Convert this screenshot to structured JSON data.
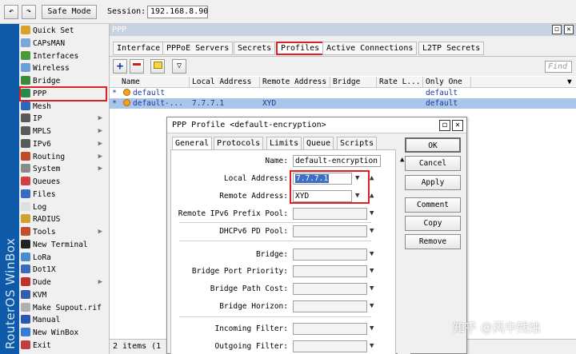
{
  "topbar": {
    "undo_icon": "undo-icon",
    "redo_icon": "redo-icon",
    "safe_mode_label": "Safe Mode",
    "session_label": "Session:",
    "session_value": "192.168.8.90"
  },
  "sidebar": {
    "brand_text": "RouterOS WinBox",
    "items": [
      {
        "label": "Quick Set",
        "icon": "quick-set-icon",
        "color": "#d9a02a",
        "arrow": false
      },
      {
        "label": "CAPsMAN",
        "icon": "capsman-icon",
        "color": "#7aa6d8",
        "arrow": false
      },
      {
        "label": "Interfaces",
        "icon": "interfaces-icon",
        "color": "#4a9a3a",
        "arrow": false
      },
      {
        "label": "Wireless",
        "icon": "wireless-icon",
        "color": "#6aa0d8",
        "arrow": false
      },
      {
        "label": "Bridge",
        "icon": "bridge-icon",
        "color": "#3a8a3a",
        "arrow": false
      },
      {
        "label": "PPP",
        "icon": "ppp-icon",
        "color": "#2a8a4a",
        "arrow": false
      },
      {
        "label": "Mesh",
        "icon": "mesh-icon",
        "color": "#2a6ab8",
        "arrow": false
      },
      {
        "label": "IP",
        "icon": "ip-icon",
        "color": "#5a5a5a",
        "arrow": true
      },
      {
        "label": "MPLS",
        "icon": "mpls-icon",
        "color": "#5a5a5a",
        "arrow": true
      },
      {
        "label": "IPv6",
        "icon": "ipv6-icon",
        "color": "#5a5a5a",
        "arrow": true
      },
      {
        "label": "Routing",
        "icon": "routing-icon",
        "color": "#c04a2a",
        "arrow": true
      },
      {
        "label": "System",
        "icon": "system-icon",
        "color": "#8a8a8a",
        "arrow": true
      },
      {
        "label": "Queues",
        "icon": "queues-icon",
        "color": "#d04040",
        "arrow": false
      },
      {
        "label": "Files",
        "icon": "files-icon",
        "color": "#3a6ac8",
        "arrow": false
      },
      {
        "label": "Log",
        "icon": "log-icon",
        "color": "#e0e0e0",
        "arrow": false
      },
      {
        "label": "RADIUS",
        "icon": "radius-icon",
        "color": "#d0a030",
        "arrow": false
      },
      {
        "label": "Tools",
        "icon": "tools-icon",
        "color": "#c05030",
        "arrow": true
      },
      {
        "label": "New Terminal",
        "icon": "terminal-icon",
        "color": "#222222",
        "arrow": false
      },
      {
        "label": "LoRa",
        "icon": "lora-icon",
        "color": "#4a8ad0",
        "arrow": false
      },
      {
        "label": "Dot1X",
        "icon": "dot1x-icon",
        "color": "#3a6ab8",
        "arrow": false
      },
      {
        "label": "Dude",
        "icon": "dude-icon",
        "color": "#c03030",
        "arrow": true
      },
      {
        "label": "KVM",
        "icon": "kvm-icon",
        "color": "#3a5ab0",
        "arrow": false
      },
      {
        "label": "Make Supout.rif",
        "icon": "supout-icon",
        "color": "#b0b0b0",
        "arrow": false
      },
      {
        "label": "Manual",
        "icon": "manual-icon",
        "color": "#2a5ab0",
        "arrow": false
      },
      {
        "label": "New WinBox",
        "icon": "winbox-icon",
        "color": "#3a7ad0",
        "arrow": false
      },
      {
        "label": "Exit",
        "icon": "exit-icon",
        "color": "#c04040",
        "arrow": false
      }
    ]
  },
  "ppp_window": {
    "title": "PPP",
    "tabs": [
      "Interface",
      "PPPoE Servers",
      "Secrets",
      "Profiles",
      "Active Connections",
      "L2TP Secrets"
    ],
    "active_tab": "Profiles",
    "find_placeholder": "Find",
    "columns": [
      "Name",
      "Local Address",
      "Remote Address",
      "Bridge",
      "Rate L...",
      "Only One"
    ],
    "rows": [
      {
        "marker": "*",
        "name": "default",
        "local": "",
        "remote": "",
        "bridge": "",
        "rate": "",
        "only_one": "default"
      },
      {
        "marker": "*",
        "name": "default-...",
        "local": "7.7.7.1",
        "remote": "XYD",
        "bridge": "",
        "rate": "",
        "only_one": "default"
      }
    ],
    "status": "2 items (1"
  },
  "dialog": {
    "title": "PPP Profile <default-encryption>",
    "tabs": [
      "General",
      "Protocols",
      "Limits",
      "Queue",
      "Scripts"
    ],
    "fields": {
      "name_label": "Name:",
      "name_value": "default-encryption",
      "local_label": "Local Address:",
      "local_value": "7.7.7.1",
      "remote_label": "Remote Address:",
      "remote_value": "XYD",
      "ipv6_pool_label": "Remote IPv6 Prefix Pool:",
      "dhcpv6_label": "DHCPv6 PD Pool:",
      "bridge_label": "Bridge:",
      "bridge_port_priority_label": "Bridge Port Priority:",
      "bridge_path_cost_label": "Bridge Path Cost:",
      "bridge_horizon_label": "Bridge Horizon:",
      "incoming_filter_label": "Incoming Filter:",
      "outgoing_filter_label": "Outgoing Filter:"
    },
    "buttons": [
      "OK",
      "Cancel",
      "Apply",
      "Comment",
      "Copy",
      "Remove"
    ]
  },
  "watermark": "知乎 @风中残烛",
  "colors": {
    "accent_red": "#e02020",
    "brand_blue": "#0f5aa8",
    "selection": "#a9c5e8"
  }
}
